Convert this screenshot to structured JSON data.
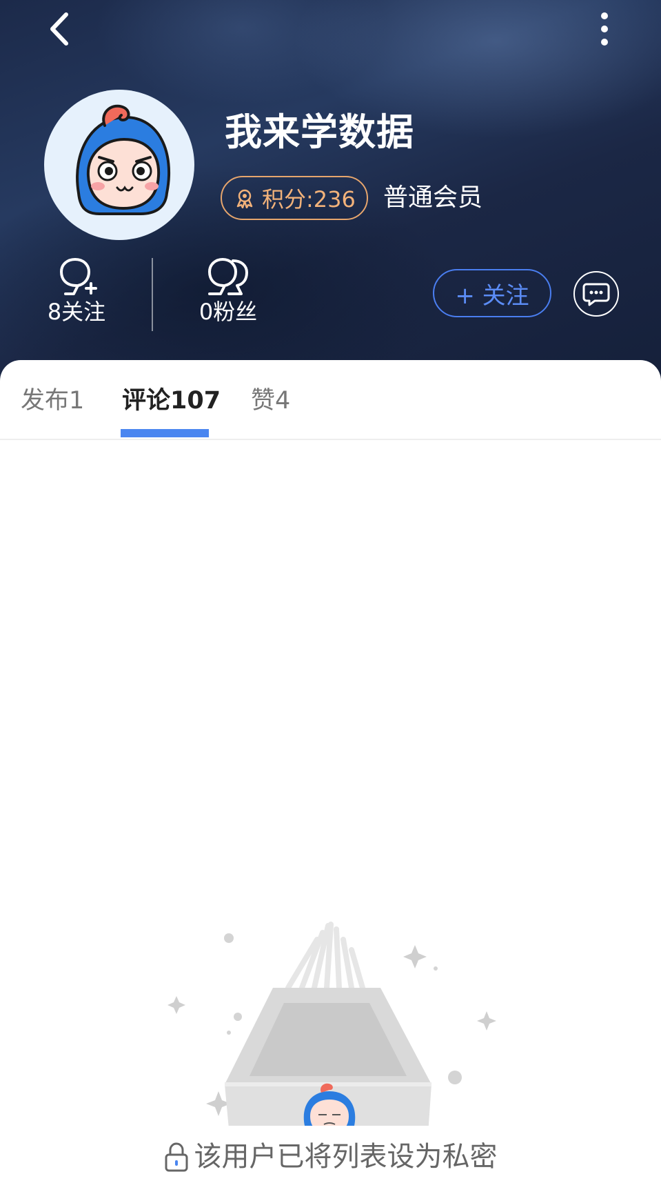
{
  "header": {
    "username": "我来学数据",
    "points_label": "积分:236",
    "member_level": "普通会员",
    "following_label": "8关注",
    "fans_label": "0粉丝",
    "follow_button_label": "+ 关注"
  },
  "tabs": [
    {
      "label": "发布1",
      "active": false
    },
    {
      "label": "评论107",
      "active": true
    },
    {
      "label": "赞4",
      "active": false
    }
  ],
  "empty_state": {
    "message": "该用户已将列表设为私密"
  },
  "colors": {
    "accent": "#4a86f0",
    "points_gold": "#e7a66d",
    "header_bg": "#1f2d4f"
  },
  "icons": [
    "back-arrow-icon",
    "more-vertical-icon",
    "medal-icon",
    "add-person-icon",
    "people-icon",
    "chat-bubble-icon",
    "lock-icon"
  ]
}
